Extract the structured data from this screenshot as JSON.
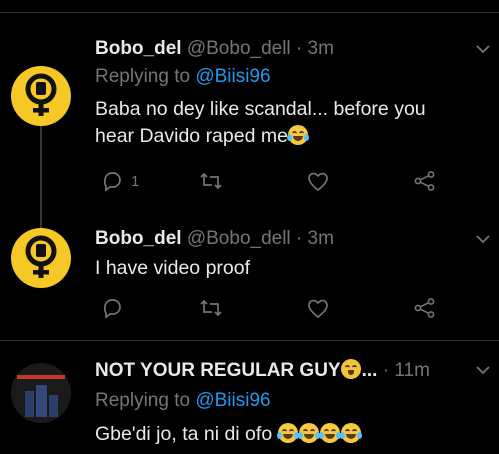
{
  "tweets": [
    {
      "name": "Bobo_del",
      "handle": "@Bobo_dell",
      "dot": "·",
      "time": "3m",
      "replying_prefix": "Replying to",
      "replying_to": "@Biisi96",
      "text_line1": "Baba no dey like scandal... before you",
      "text_line2": "hear Davido raped me",
      "reply_count": "1"
    },
    {
      "name": "Bobo_del",
      "handle": "@Bobo_dell",
      "dot": "·",
      "time": "3m",
      "text": "I have video proof",
      "reply_count": ""
    },
    {
      "name": "NOT YOUR REGULAR GUY",
      "ellipsis": "...",
      "dot": "·",
      "time": "11m",
      "replying_prefix": "Replying to",
      "replying_to": "@Biisi96",
      "text": "Gbe'di jo, ta ni di ofo"
    }
  ],
  "icons": {
    "reply": "reply-icon",
    "retweet": "retweet-icon",
    "like": "heart-icon",
    "share": "share-icon",
    "more": "chevron-down-icon"
  },
  "colors": {
    "background": "#000000",
    "text": "#e7e9ea",
    "muted": "#71767b",
    "link": "#1d9bf0",
    "avatar": "#f5c826"
  }
}
